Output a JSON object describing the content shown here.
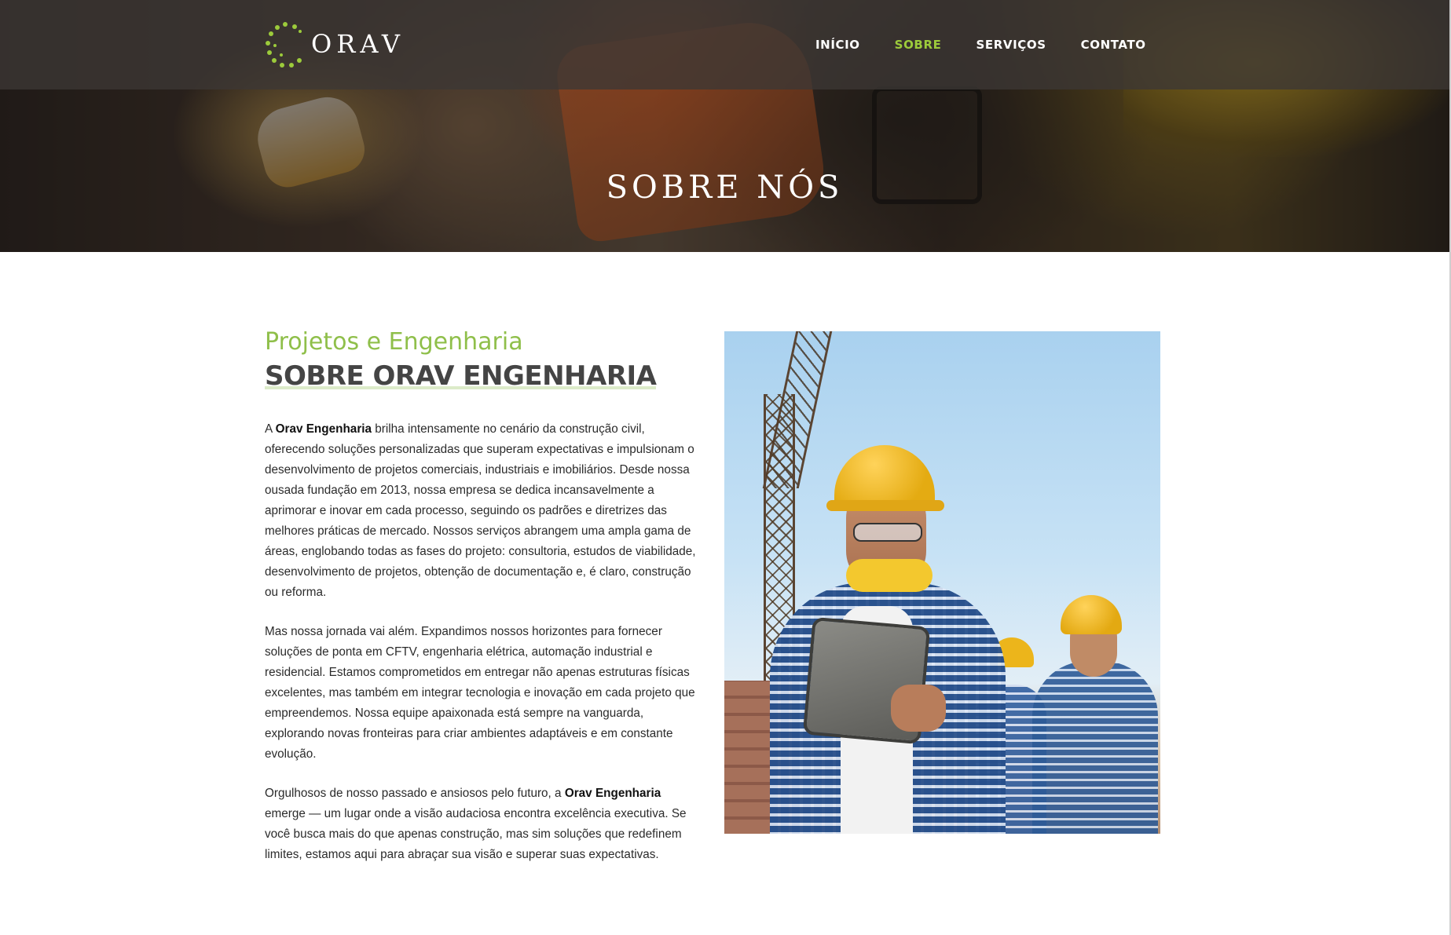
{
  "brand": {
    "name": "ORAV",
    "accent": "#9ccb3b"
  },
  "nav": {
    "items": [
      {
        "label": "INÍCIO",
        "active": false
      },
      {
        "label": "SOBRE",
        "active": true
      },
      {
        "label": "SERVIÇOS",
        "active": false
      },
      {
        "label": "CONTATO",
        "active": false
      }
    ]
  },
  "hero": {
    "title": "SOBRE NÓS"
  },
  "about": {
    "subtitle": "Projetos e Engenharia",
    "title": "SOBRE ORAV ENGENHARIA",
    "company": "Orav Engenharia",
    "p1_a": "A ",
    "p1_b": " brilha intensamente no cenário da construção civil, oferecendo soluções personalizadas que superam expectativas e impulsionam o desenvolvimento de projetos comerciais, industriais e imobiliários. Desde nossa ousada fundação em 2013, nossa empresa se dedica incansavelmente a aprimorar e inovar em cada processo, seguindo os padrões e diretrizes das melhores práticas de mercado. Nossos serviços abrangem uma ampla gama de áreas, englobando todas as fases do projeto: consultoria, estudos de viabilidade, desenvolvimento de projetos, obtenção de documentação e, é claro, construção ou reforma.",
    "p2": "Mas nossa jornada vai além. Expandimos nossos horizontes para fornecer soluções de ponta em CFTV, engenharia elétrica, automação industrial e residencial. Estamos comprometidos em entregar não apenas estruturas físicas excelentes, mas também em integrar tecnologia e inovação em cada projeto que empreendemos. Nossa equipe apaixonada está sempre na vanguarda, explorando novas fronteiras para criar ambientes adaptáveis e em constante evolução.",
    "p3_a": "Orgulhosos de nosso passado e ansiosos pelo futuro, a ",
    "p3_b": " emerge — um lugar onde a visão audaciosa encontra excelência executiva. Se você busca mais do que apenas construção, mas sim soluções que redefinem limites, estamos aqui para abraçar sua visão e superar suas expectativas."
  }
}
